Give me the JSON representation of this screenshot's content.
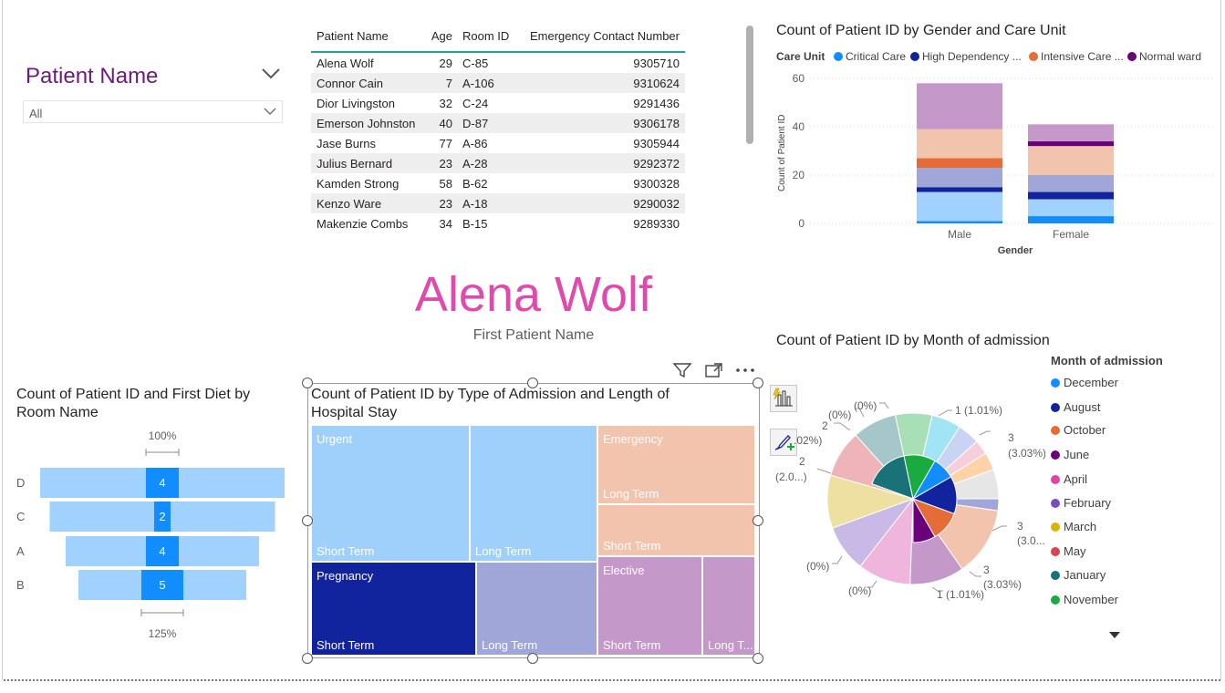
{
  "slicer": {
    "title": "Patient Name",
    "selected": "All"
  },
  "table": {
    "headers": [
      "Patient Name",
      "Age",
      "Room ID",
      "Emergency Contact Number"
    ],
    "rows": [
      [
        "Alena Wolf",
        "29",
        "C-85",
        "9305710"
      ],
      [
        "Connor Cain",
        "7",
        "A-106",
        "9310624"
      ],
      [
        "Dior Livingston",
        "32",
        "C-24",
        "9291436"
      ],
      [
        "Emerson Johnston",
        "40",
        "D-87",
        "9306178"
      ],
      [
        "Jase Burns",
        "77",
        "A-86",
        "9305944"
      ],
      [
        "Julius Bernard",
        "23",
        "A-28",
        "9292372"
      ],
      [
        "Kamden Strong",
        "58",
        "B-62",
        "9300328"
      ],
      [
        "Kenzo Ware",
        "23",
        "A-18",
        "9290032"
      ],
      [
        "Makenzie Combs",
        "34",
        "B-15",
        "9289330"
      ]
    ]
  },
  "card": {
    "value": "Alena Wolf",
    "label": "First Patient Name"
  },
  "colors": {
    "critical_care": "#118dff",
    "high_dependency": "#12239e",
    "intensive_care": "#e66c37",
    "normal_ward": "#6b007b",
    "card_text": "#e04aae",
    "slicer_title": "#6b1a7e"
  },
  "charts": {
    "gender": {
      "title": "Count of Patient ID by Gender and Care Unit",
      "legend_title": "Care Unit",
      "legend": [
        "Critical Care",
        "High Dependency ...",
        "Intensive Care ...",
        "Normal ward"
      ],
      "ylabel": "Count of Patient ID",
      "xlabel": "Gender",
      "yticks": [
        "60",
        "40",
        "20",
        "0"
      ],
      "categories": [
        "Male",
        "Female"
      ]
    },
    "funnel": {
      "title": "Count of Patient ID and First Diet by Room Name",
      "top_label": "100%",
      "bottom_label": "125%"
    },
    "treemap": {
      "title": "Count of Patient ID by Type of Admission and Length of Hospital Stay",
      "cells": [
        {
          "top": "Urgent",
          "bottom": "Short Term"
        },
        {
          "top": "",
          "bottom": "Long Term"
        },
        {
          "top": "Emergency",
          "bottom": "Long Term"
        },
        {
          "top": "",
          "bottom": "Short Term"
        },
        {
          "top": "Pregnancy",
          "bottom": "Short Term"
        },
        {
          "top": "",
          "bottom": "Long Term"
        },
        {
          "top": "Elective",
          "bottom": "Short Term"
        },
        {
          "top": "",
          "bottom": "Long T..."
        }
      ]
    },
    "pie": {
      "title": "Count of Patient ID by Month of admission",
      "legend_title": "Month of admission",
      "legend": [
        {
          "label": "December",
          "color": "#118dff"
        },
        {
          "label": "August",
          "color": "#12239e"
        },
        {
          "label": "October",
          "color": "#e66c37"
        },
        {
          "label": "June",
          "color": "#6b007b"
        },
        {
          "label": "April",
          "color": "#e044a7"
        },
        {
          "label": "February",
          "color": "#744ec2"
        },
        {
          "label": "March",
          "color": "#d9b300"
        },
        {
          "label": "May",
          "color": "#d64550"
        },
        {
          "label": "January",
          "color": "#197278"
        },
        {
          "label": "November",
          "color": "#1aab40"
        }
      ],
      "labels": [
        "1 (1.01%)",
        "3",
        "(3.03%)",
        "3",
        "(3.0...)",
        "3",
        "(3.03%)",
        "1 (1.01%)",
        "(0%)",
        "(0%)",
        "2",
        "(2.0...)",
        "2",
        ".02%)",
        "(0%)",
        "(0%)"
      ]
    }
  },
  "chart_data": [
    {
      "type": "bar",
      "title": "Count of Patient ID by Gender and Care Unit",
      "xlabel": "Gender",
      "ylabel": "Count of Patient ID",
      "ylim": [
        0,
        60
      ],
      "grid": true,
      "legend_placement": "top",
      "categories": [
        "Male",
        "Female"
      ],
      "series": [
        {
          "name": "Critical Care",
          "values": [
            1,
            3
          ]
        },
        {
          "name": "Critical Care (overlay)",
          "values": [
            12,
            7
          ]
        },
        {
          "name": "High Dependency ...",
          "values": [
            2,
            3
          ]
        },
        {
          "name": "High Dependency ... (overlay)",
          "values": [
            8,
            7
          ]
        },
        {
          "name": "Intensive Care ...",
          "values": [
            4,
            0
          ]
        },
        {
          "name": "Intensive Care ... (overlay)",
          "values": [
            12,
            12
          ]
        },
        {
          "name": "Normal ward",
          "values": [
            0,
            2
          ]
        },
        {
          "name": "Normal ward (overlay)",
          "values": [
            19,
            7
          ]
        }
      ]
    },
    {
      "type": "bar",
      "title": "Count of Patient ID and First Diet by Room Name",
      "categories": [
        "D",
        "C",
        "A",
        "B"
      ],
      "series": [
        {
          "name": "Count of Patient ID",
          "values": [
            4,
            2,
            4,
            5
          ]
        }
      ],
      "bar_widths": [
        268,
        247,
        212,
        184
      ]
    },
    {
      "type": "pie",
      "title": "Count of Patient ID by Month of admission",
      "categories": [
        "December",
        "August",
        "October",
        "June",
        "April",
        "February",
        "March",
        "May",
        "January",
        "November"
      ],
      "values": [
        1,
        3,
        3,
        3,
        1,
        0,
        0,
        0,
        2,
        2
      ]
    }
  ]
}
